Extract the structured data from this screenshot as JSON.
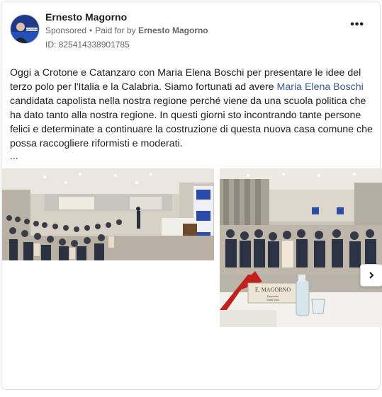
{
  "post": {
    "author": "Ernesto Magorno",
    "sponsored": "Sponsored",
    "paid_prefix": "Paid for by",
    "paid_by": "Ernesto Magorno",
    "ad_id": "ID: 825414338901785",
    "more_label": "•••",
    "text_part1": "Oggi a Crotone e Catanzaro con Maria Elena Boschi per presentare le idee del terzo polo per l'Italia e la Calabria. Siamo fortunati ad avere ",
    "text_link": "Maria Elena Boschi",
    "text_part2": " candidata capolista nella nostra regione perché viene da una scuola politica che ha dato tanto alla nostra regione. In questi giorni sto incontrando tante persone felici e determinate a continuare la costruzione di questa nuova casa comune che possa raccogliere riformisti e moderati.",
    "ellipsis": "...",
    "placard_name": "E. MAGORNO",
    "placard_sub1": "Deputato",
    "placard_sub2": "Italia Viva",
    "avatar_text": "MAGORNO"
  },
  "icons": {
    "more": "more-options-icon",
    "next": "chevron-right-icon"
  },
  "colors": {
    "link": "#385898",
    "meta": "#65676b",
    "text": "#1c1e21"
  }
}
